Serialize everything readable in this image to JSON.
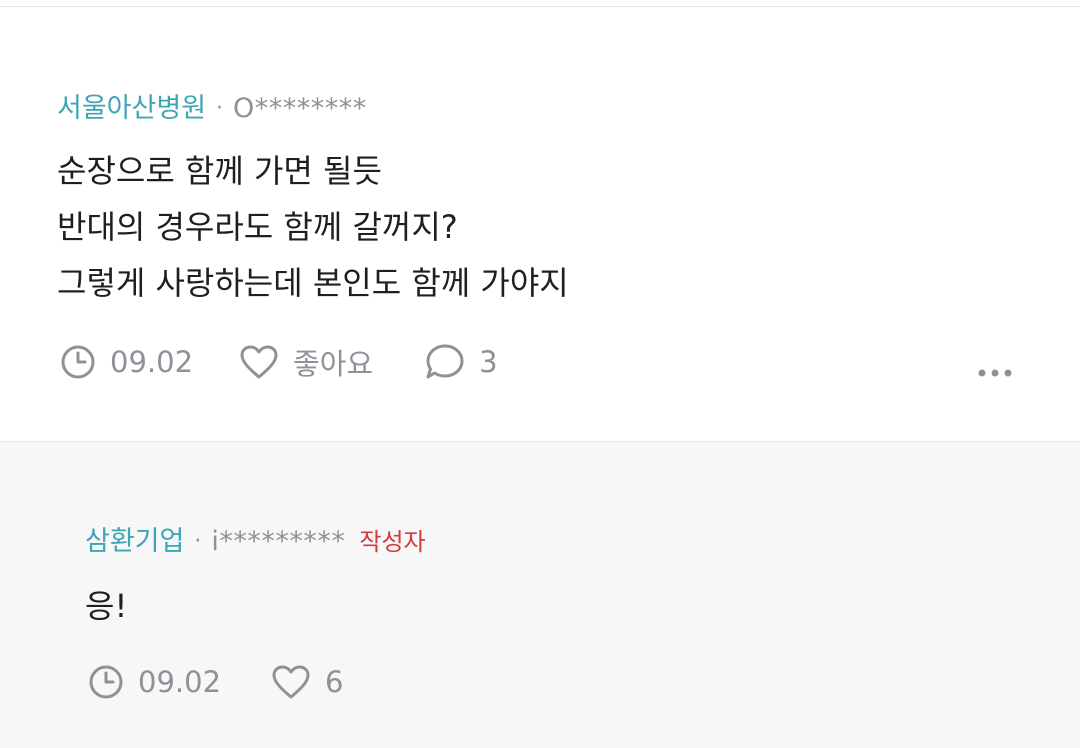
{
  "main_comment": {
    "company": "서울아산병원",
    "separator": "·",
    "author": "O********",
    "body": "순장으로 함께 가면 될듯\n반대의 경우라도 함께 갈꺼지?\n그렇게 사랑하는데 본인도 함께 가야지",
    "date": "09.02",
    "like_label": "좋아요",
    "reply_count": "3",
    "icons": {
      "date": "clock-icon",
      "like": "heart-icon",
      "reply": "speech-bubble-icon",
      "more": "more-dots-icon"
    }
  },
  "reply_comment": {
    "company": "삼환기업",
    "separator": "·",
    "author": "i*********",
    "author_badge": "작성자",
    "body": "응!",
    "date": "09.02",
    "like_count": "6",
    "icons": {
      "date": "clock-icon",
      "like": "heart-icon"
    }
  },
  "colors": {
    "company": "#3fa5b5",
    "meta_gray": "#8e9298",
    "badge_red": "#d13b3b",
    "body_text": "#1f1f22",
    "reply_bg": "#f7f7f8"
  }
}
